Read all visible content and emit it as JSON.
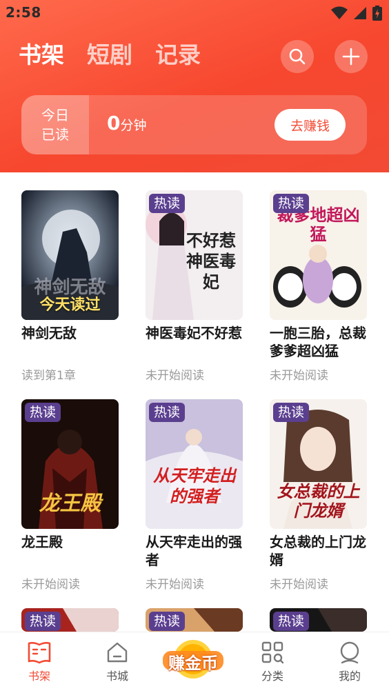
{
  "status_bar": {
    "time": "2:58"
  },
  "header": {
    "tabs": [
      {
        "label": "书架",
        "active": true
      },
      {
        "label": "短剧",
        "active": false
      },
      {
        "label": "记录",
        "active": false
      }
    ],
    "search_icon": "search-icon",
    "add_icon": "plus-icon"
  },
  "reading_card": {
    "label_line1": "今日",
    "label_line2": "已读",
    "minutes": "0",
    "unit": "分钟",
    "earn_button": "去赚钱"
  },
  "books": [
    {
      "title": "神剑无敌",
      "status": "读到第1章",
      "badge": "",
      "overlay": "今天读过",
      "cover_text": "神剑无敌"
    },
    {
      "title": "神医毒妃不好惹",
      "status": "未开始阅读",
      "badge": "热读",
      "cover_text": "不好惹神医毒妃"
    },
    {
      "title": "一胞三胎，总裁爹爹超凶猛",
      "status": "未开始阅读",
      "badge": "热读",
      "cover_text": "裁爹地超凶猛"
    },
    {
      "title": "龙王殿",
      "status": "未开始阅读",
      "badge": "热读",
      "cover_text": "龙王殿"
    },
    {
      "title": "从天牢走出的强者",
      "status": "未开始阅读",
      "badge": "热读",
      "cover_text": "从天牢走出的强者"
    },
    {
      "title": "女总裁的上门龙婿",
      "status": "未开始阅读",
      "badge": "热读",
      "cover_text": "女总裁的上门龙婿"
    },
    {
      "title": "",
      "status": "",
      "badge": "热读",
      "cover_text": ""
    },
    {
      "title": "",
      "status": "",
      "badge": "热读",
      "cover_text": ""
    },
    {
      "title": "",
      "status": "",
      "badge": "热读",
      "cover_text": ""
    }
  ],
  "bottom_nav": {
    "items": [
      {
        "label": "书架",
        "icon": "bookshelf-icon",
        "active": true
      },
      {
        "label": "书城",
        "icon": "home-icon",
        "active": false
      },
      {
        "label": "分类",
        "icon": "category-icon",
        "active": false
      },
      {
        "label": "我的",
        "icon": "profile-icon",
        "active": false
      }
    ],
    "earn_coins_label": "赚金币"
  },
  "colors": {
    "brand_red": "#f24a34",
    "badge_purple": "#5b3f8f",
    "gold": "#ffb300"
  }
}
